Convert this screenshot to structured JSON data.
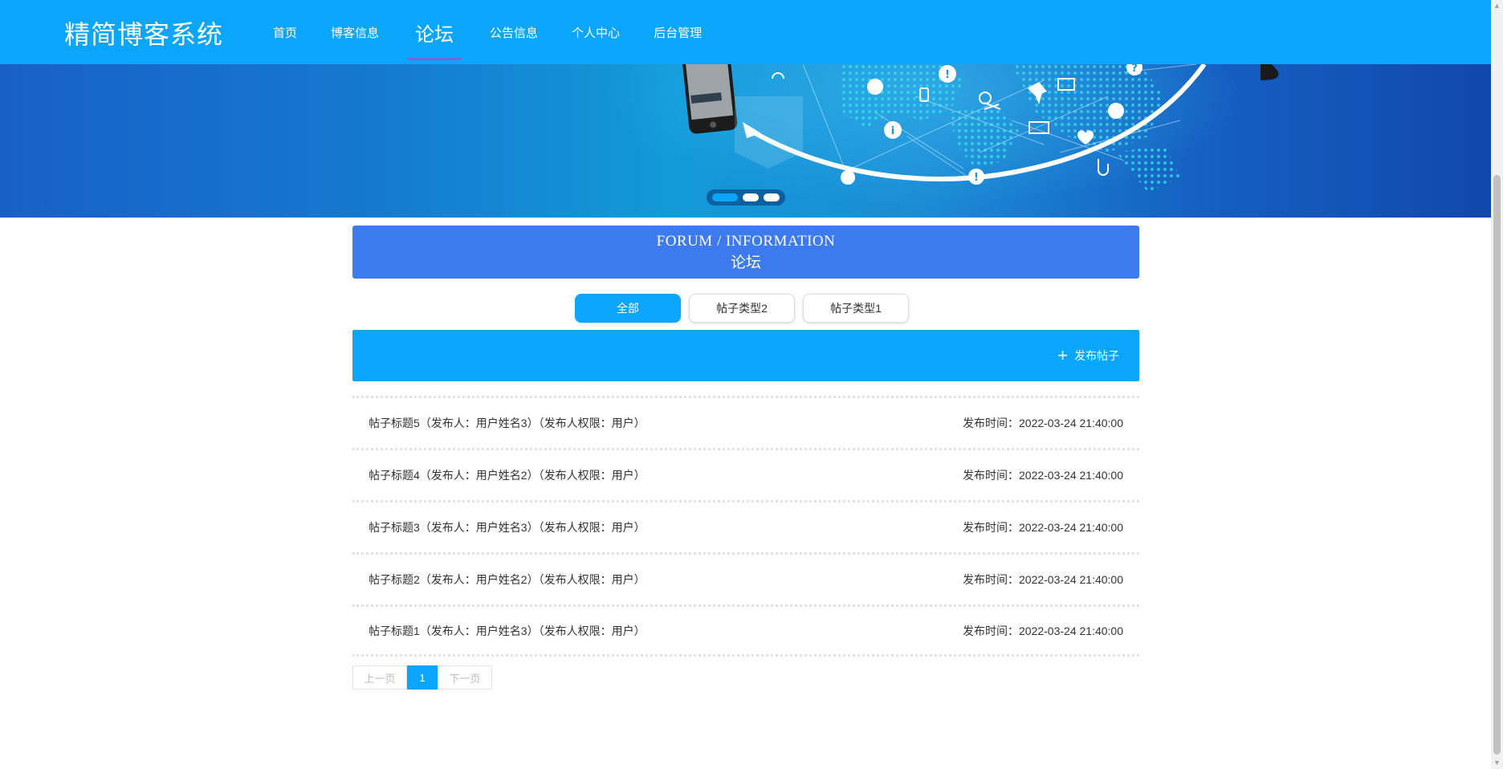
{
  "header": {
    "brand": "精简博客系统",
    "nav": [
      {
        "label": "首页",
        "active": false
      },
      {
        "label": "博客信息",
        "active": false
      },
      {
        "label": "论坛",
        "active": true
      },
      {
        "label": "公告信息",
        "active": false
      },
      {
        "label": "个人中心",
        "active": false
      },
      {
        "label": "后台管理",
        "active": false
      }
    ]
  },
  "banner": {
    "slide_count": 3,
    "active_slide": 1
  },
  "section": {
    "title_en": "FORUM / INFORMATION",
    "title_cn": "论坛"
  },
  "tabs": [
    {
      "label": "全部",
      "active": true
    },
    {
      "label": "帖子类型2",
      "active": false
    },
    {
      "label": "帖子类型1",
      "active": false
    }
  ],
  "actions": {
    "publish_icon": "plus-icon",
    "publish_label": "发布帖子"
  },
  "posts": [
    {
      "title": "帖子标题5（发布人：用户姓名3）（发布人权限：用户）",
      "time": "发布时间：2022-03-24 21:40:00"
    },
    {
      "title": "帖子标题4（发布人：用户姓名2）（发布人权限：用户）",
      "time": "发布时间：2022-03-24 21:40:00"
    },
    {
      "title": "帖子标题3（发布人：用户姓名3）（发布人权限：用户）",
      "time": "发布时间：2022-03-24 21:40:00"
    },
    {
      "title": "帖子标题2（发布人：用户姓名2）（发布人权限：用户）",
      "time": "发布时间：2022-03-24 21:40:00"
    },
    {
      "title": "帖子标题1（发布人：用户姓名3）（发布人权限：用户）",
      "time": "发布时间：2022-03-24 21:40:00"
    }
  ],
  "pagination": {
    "prev": "上一页",
    "current": "1",
    "next": "下一页"
  },
  "colors": {
    "primary": "#0aa5fc",
    "section_bg": "#3d79ef",
    "nav_underline": "#7b63d6"
  }
}
